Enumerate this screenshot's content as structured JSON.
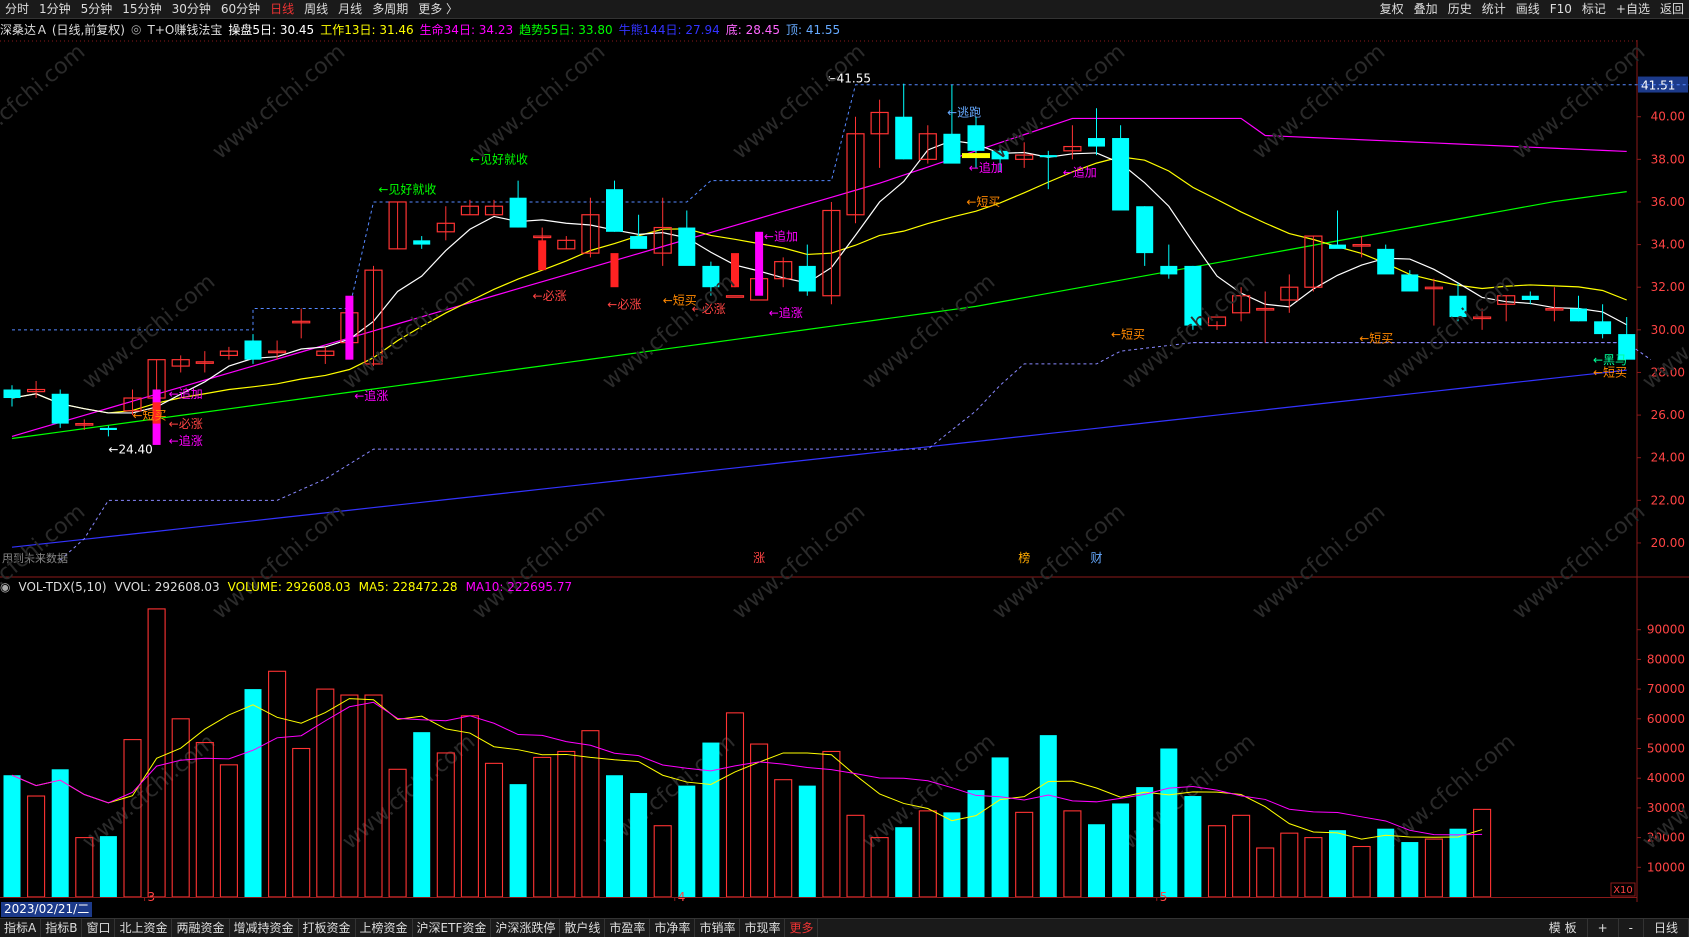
{
  "toolbar": {
    "left": [
      "分时",
      "1分钟",
      "5分钟",
      "15分钟",
      "30分钟",
      "60分钟",
      "日线",
      "周线",
      "月线",
      "多周期",
      "更多 〉"
    ],
    "active": "日线",
    "right": [
      "复权",
      "叠加",
      "历史",
      "统计",
      "画线",
      "F10",
      "标记",
      "+自选",
      "返回"
    ]
  },
  "info": {
    "title": "深桑达Ａ (日线,前复权)",
    "indicator": "T+O赚钱法宝",
    "items": [
      {
        "text": "操盘5日: 30.45",
        "color": "#ffffff"
      },
      {
        "text": "工作13日: 31.46",
        "color": "#ffff00"
      },
      {
        "text": "生命34日: 34.23",
        "color": "#ff00ff"
      },
      {
        "text": "趋势55日: 33.80",
        "color": "#00ff00"
      },
      {
        "text": "牛熊144日: 27.94",
        "color": "#3333ff"
      },
      {
        "text": "底: 28.45",
        "color": "#ff66ff"
      },
      {
        "text": "顶: 41.55",
        "color": "#66aaff"
      }
    ]
  },
  "colors": {
    "up": "#ff3333",
    "down": "#00ffff",
    "ma5": "#ffffff",
    "ma13": "#ffff00",
    "ma34": "#ff00ff",
    "ma55": "#00ff00",
    "ma144": "#3333ff"
  },
  "price_axis": {
    "ticks": [
      "40.00",
      "38.00",
      "36.00",
      "34.00",
      "32.00",
      "30.00",
      "28.00",
      "26.00",
      "24.00",
      "22.00",
      "20.00"
    ],
    "last": "41.51"
  },
  "vol_axis": {
    "ticks": [
      "90000",
      "80000",
      "70000",
      "60000",
      "50000",
      "40000",
      "30000",
      "20000",
      "10000"
    ],
    "unit": "X10"
  },
  "candles": [
    [
      27.2,
      27.4,
      26.4,
      26.8
    ],
    [
      27.1,
      27.6,
      26.8,
      27.2
    ],
    [
      27.0,
      27.2,
      25.4,
      25.6
    ],
    [
      25.6,
      25.8,
      25.3,
      25.6
    ],
    [
      25.4,
      25.5,
      25.0,
      25.3
    ],
    [
      26.2,
      27.2,
      26.0,
      26.8
    ],
    [
      26.8,
      28.6,
      26.4,
      28.6
    ],
    [
      28.3,
      28.8,
      28.0,
      28.6
    ],
    [
      28.5,
      29.0,
      28.0,
      28.5
    ],
    [
      28.8,
      29.2,
      28.6,
      29.0
    ],
    [
      29.5,
      29.8,
      28.4,
      28.6
    ],
    [
      29.0,
      29.5,
      28.6,
      29.0
    ],
    [
      30.4,
      31.0,
      29.6,
      30.4
    ],
    [
      28.8,
      29.2,
      28.4,
      29.0
    ],
    [
      29.4,
      31.0,
      29.2,
      30.8
    ],
    [
      28.4,
      33.0,
      28.3,
      32.8
    ],
    [
      33.8,
      36.0,
      33.8,
      36.0
    ],
    [
      34.2,
      34.4,
      33.8,
      34.0
    ],
    [
      34.6,
      35.8,
      34.2,
      35.0
    ],
    [
      35.4,
      36.1,
      35.4,
      35.8
    ],
    [
      35.4,
      36.1,
      35.4,
      35.8
    ],
    [
      36.2,
      37.0,
      34.8,
      34.8
    ],
    [
      34.4,
      34.8,
      33.8,
      34.4
    ],
    [
      33.8,
      34.4,
      33.8,
      34.2
    ],
    [
      33.6,
      36.2,
      33.4,
      35.4
    ],
    [
      36.6,
      37.0,
      34.6,
      34.6
    ],
    [
      34.4,
      35.4,
      34.2,
      33.8
    ],
    [
      33.6,
      36.2,
      33.0,
      34.8
    ],
    [
      34.8,
      35.6,
      34.0,
      33.0
    ],
    [
      33.0,
      33.2,
      31.6,
      32.0
    ],
    [
      31.6,
      33.0,
      32.0,
      31.6
    ],
    [
      31.4,
      32.0,
      31.8,
      32.4
    ],
    [
      32.4,
      33.4,
      32.0,
      33.2
    ],
    [
      33.0,
      34.0,
      31.6,
      31.8
    ],
    [
      31.6,
      36.0,
      31.2,
      35.6
    ],
    [
      35.4,
      40.0,
      35.0,
      39.2
    ],
    [
      39.2,
      40.8,
      37.6,
      40.2
    ],
    [
      40.0,
      41.55,
      38.0,
      38.0
    ],
    [
      38.0,
      39.6,
      37.8,
      39.2
    ],
    [
      39.2,
      41.5,
      38.0,
      37.8
    ],
    [
      39.6,
      40.0,
      37.6,
      38.4
    ],
    [
      38.4,
      38.6,
      37.4,
      38.0
    ],
    [
      38.0,
      38.8,
      37.6,
      38.2
    ],
    [
      38.2,
      38.4,
      36.6,
      38.1
    ],
    [
      38.4,
      39.6,
      38.0,
      38.6
    ],
    [
      39.0,
      40.4,
      38.2,
      38.6
    ],
    [
      39.0,
      39.6,
      35.8,
      35.6
    ],
    [
      35.8,
      35.8,
      33.0,
      33.6
    ],
    [
      33.0,
      34.0,
      32.4,
      32.6
    ],
    [
      33.0,
      33.0,
      30.0,
      30.2
    ],
    [
      30.2,
      30.4,
      30.0,
      30.6
    ],
    [
      30.8,
      32.0,
      30.4,
      31.6
    ],
    [
      31.0,
      31.8,
      29.4,
      31.0
    ],
    [
      31.4,
      32.6,
      30.8,
      32.0
    ],
    [
      32.0,
      34.4,
      31.8,
      34.4
    ],
    [
      34.0,
      35.6,
      34.0,
      33.8
    ],
    [
      34.0,
      34.4,
      33.4,
      34.0
    ],
    [
      33.8,
      34.0,
      32.8,
      32.6
    ],
    [
      32.6,
      32.8,
      31.8,
      31.8
    ],
    [
      32.0,
      32.4,
      30.2,
      32.0
    ],
    [
      31.6,
      32.2,
      30.4,
      30.6
    ],
    [
      30.6,
      31.0,
      30.0,
      30.6
    ],
    [
      31.2,
      31.6,
      30.4,
      31.6
    ],
    [
      31.6,
      31.8,
      31.2,
      31.4
    ],
    [
      31.0,
      32.0,
      30.4,
      31.0
    ],
    [
      31.0,
      31.6,
      30.4,
      30.4
    ],
    [
      30.4,
      31.2,
      29.6,
      29.8
    ],
    [
      29.8,
      30.6,
      28.8,
      28.6
    ]
  ],
  "volumes": [
    41000,
    34000,
    43000,
    20000,
    20500,
    53000,
    97000,
    60000,
    52000,
    44500,
    70000,
    76000,
    50000,
    70000,
    68000,
    68000,
    43000,
    55500,
    48500,
    61000,
    45000,
    38000,
    47000,
    49000,
    56000,
    41000,
    35000,
    24000,
    37500,
    52000,
    62000,
    51500,
    39500,
    37500,
    49000,
    27500,
    20000,
    23500,
    29000,
    28500,
    36000,
    47000,
    28500,
    54500,
    29000,
    24500,
    31500,
    37000,
    50000,
    34000,
    24000,
    27500,
    16500,
    21500,
    20000,
    22500,
    17000,
    23000,
    18500,
    19500,
    23000,
    29500
  ],
  "annotations": {
    "peak": "41.55",
    "low": "24.40",
    "signals": [
      {
        "text": "←见好就收",
        "color": "#00ff00"
      },
      {
        "text": "←见好就收",
        "color": "#00ff00"
      },
      {
        "text": "←追加",
        "color": "#ff00ff"
      },
      {
        "text": "←短买",
        "color": "#ff8800"
      },
      {
        "text": "←必涨",
        "color": "#ff4444"
      },
      {
        "text": "←追涨",
        "color": "#ff00ff"
      },
      {
        "text": "←追涨",
        "color": "#ff00ff"
      },
      {
        "text": "←必涨",
        "color": "#ff4444"
      },
      {
        "text": "←必涨",
        "color": "#ff4444"
      },
      {
        "text": "←短买",
        "color": "#ff8800"
      },
      {
        "text": "←追加",
        "color": "#ff00ff"
      },
      {
        "text": "←必涨",
        "color": "#ff4444"
      },
      {
        "text": "←追涨",
        "color": "#ff00ff"
      },
      {
        "text": "←逃跑",
        "color": "#66aaff"
      },
      {
        "text": "←追加",
        "color": "#ff00ff"
      },
      {
        "text": "←短买",
        "color": "#ff8800"
      },
      {
        "text": "←短买",
        "color": "#ff8800"
      },
      {
        "text": "←短买",
        "color": "#ff8800"
      },
      {
        "text": "←黑马",
        "color": "#00ff99"
      },
      {
        "text": "←短买",
        "color": "#ff8800"
      },
      {
        "text": "←追加",
        "color": "#ff00ff"
      }
    ],
    "markers": [
      {
        "text": "涨",
        "color": "#ff4444"
      },
      {
        "text": "榜",
        "color": "#ffaa00"
      },
      {
        "text": "财",
        "color": "#66aaff"
      }
    ],
    "nodata": "用到未来数据"
  },
  "vol_info": {
    "title": "VOL-TDX(5,10)",
    "vvol": "VVOL: 292608.03",
    "volume": "VOLUME: 292608.03",
    "ma5": "MA5: 228472.28",
    "ma10": "MA10: 222695.77"
  },
  "months": [
    "3",
    "4",
    "5"
  ],
  "date_label": "2023/02/21/二",
  "bottom_tabs": [
    "指标A",
    "指标B",
    "窗口",
    "北上资金",
    "两融资金",
    "增减持资金",
    "打板资金",
    "上榜资金",
    "沪深ETF资金",
    "沪深涨跌停",
    "散户线",
    "市盈率",
    "市净率",
    "市销率",
    "市现率",
    "更多"
  ],
  "bottom_right": [
    "模 板",
    "+",
    "-",
    "日线"
  ],
  "bottom_right_corner": "日线"
}
